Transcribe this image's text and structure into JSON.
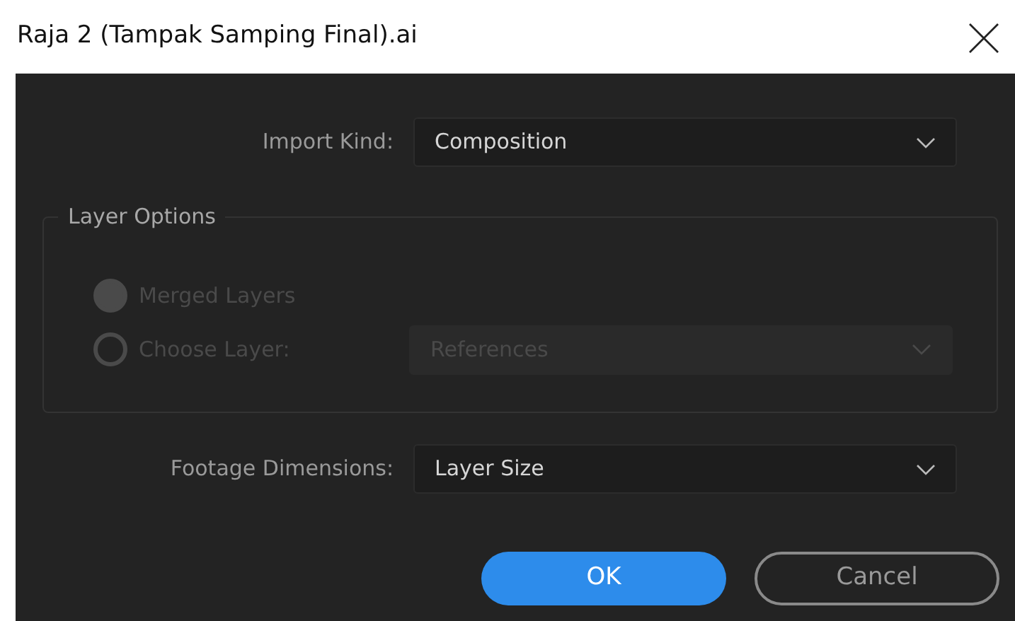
{
  "window": {
    "title": "Raja 2 (Tampak Samping Final).ai"
  },
  "import_kind": {
    "label": "Import Kind:",
    "value": "Composition",
    "disabled": false
  },
  "layer_options": {
    "title": "Layer Options",
    "disabled": true,
    "options": [
      {
        "label": "Merged Layers",
        "selected": true
      },
      {
        "label": "Choose Layer:",
        "selected": false
      }
    ],
    "layer_select": {
      "value": "References",
      "disabled": true
    }
  },
  "footage_dimensions": {
    "label": "Footage Dimensions:",
    "value": "Layer Size",
    "disabled": false
  },
  "buttons": [
    {
      "label": "OK",
      "kind": "primary"
    },
    {
      "label": "Cancel",
      "kind": "secondary"
    }
  ]
}
